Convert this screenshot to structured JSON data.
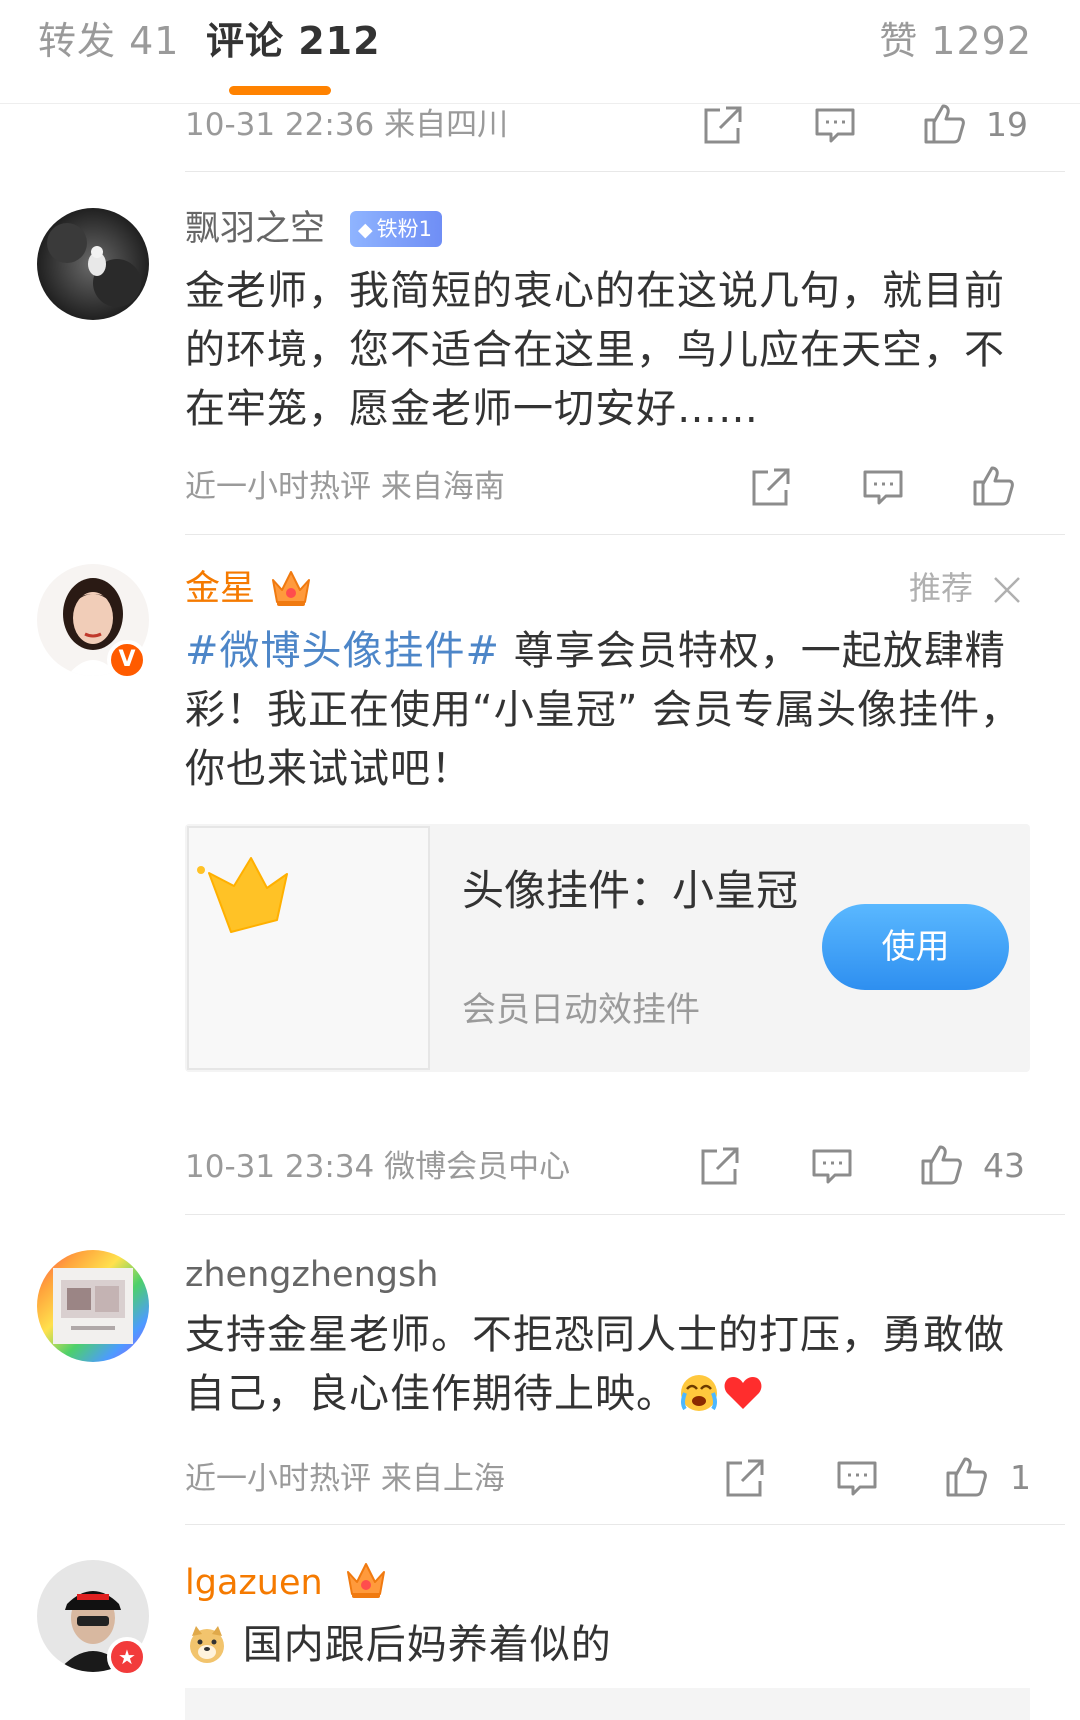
{
  "tabs": {
    "repost": "转发 41",
    "comments": "评论 212",
    "likes": "赞 1292"
  },
  "colors": {
    "accent": "#ff8200",
    "topic_link": "#4d86c8",
    "vip_name": "#f57a00",
    "use_button": "#2e8ff0"
  },
  "top_partial": {
    "meta": "10-31 22:36  来自四川",
    "like_count": "19"
  },
  "comments": [
    {
      "username": "飘羽之空",
      "fan_badge": "铁粉1",
      "text": "金老师，我简短的衷心的在这说几句，就目前的环境，您不适合在这里，鸟儿应在天空，不在牢笼，愿金老师一切安好……",
      "meta": "近一小时热评  来自海南",
      "like_count": ""
    },
    {
      "username": "金星",
      "recommend": "推荐",
      "topic": "#微博头像挂件#",
      "text": " 尊享会员特权，一起放肆精彩！我正在使用“小皇冠” 会员专属头像挂件，你也来试试吧！",
      "card": {
        "title": "头像挂件：小皇冠",
        "subtitle": "会员日动效挂件",
        "button": "使用"
      },
      "meta": "10-31 23:34  微博会员中心",
      "like_count": "43"
    },
    {
      "username": "zhengzhengsh",
      "text": "支持金星老师。不拒恐同人士的打压，勇敢做自己，良心佳作期待上映。",
      "meta": "近一小时热评  来自上海",
      "like_count": "1"
    },
    {
      "username": "lgazuen",
      "text": " 国内跟后妈养着似的"
    }
  ]
}
